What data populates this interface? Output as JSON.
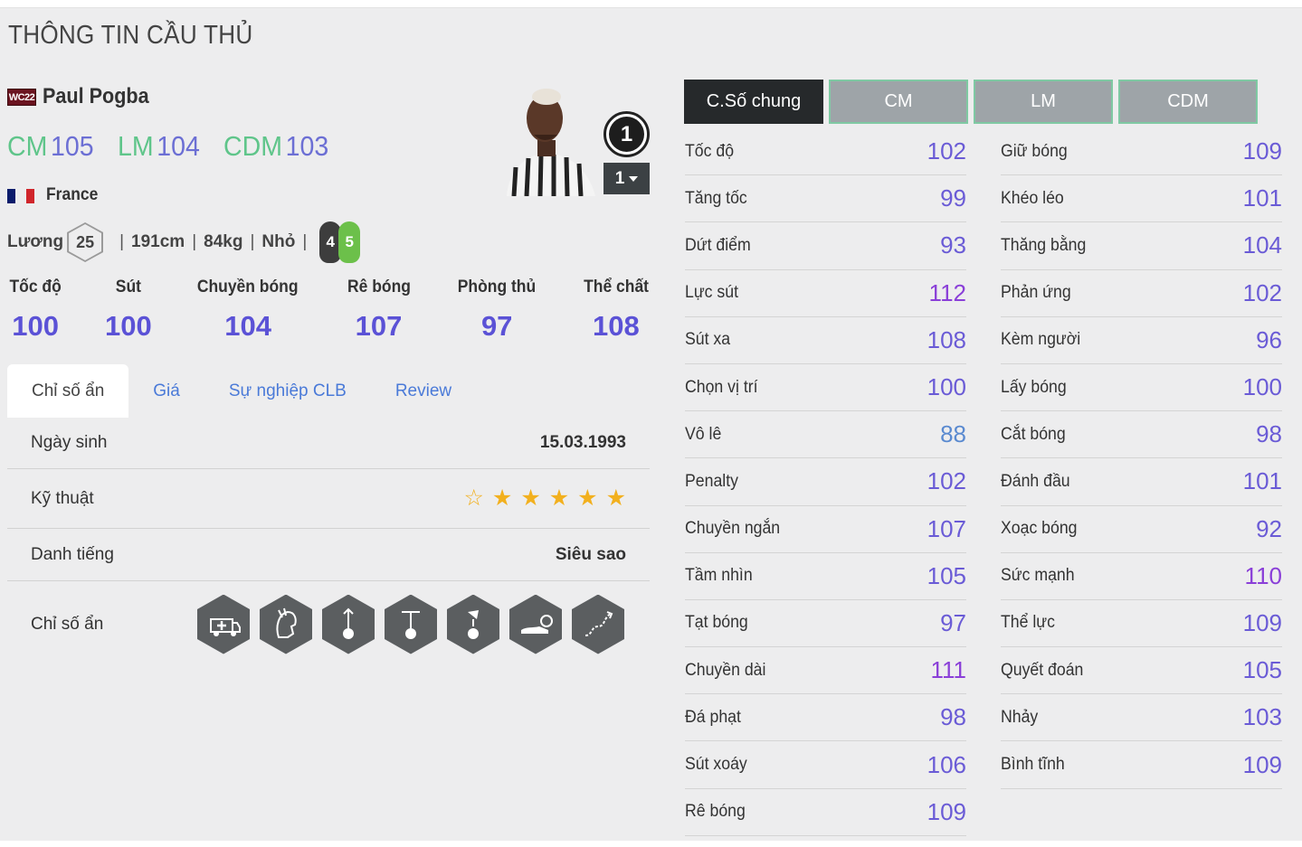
{
  "page": {
    "title": "THÔNG TIN CẦU THỦ"
  },
  "player": {
    "season_badge": "WC22",
    "name": "Paul Pogba",
    "positions": [
      {
        "pos": "CM",
        "value": "105"
      },
      {
        "pos": "LM",
        "value": "104"
      },
      {
        "pos": "CDM",
        "value": "103"
      }
    ],
    "nation": "France",
    "salary_label": "Lương",
    "salary": "25",
    "height": "191cm",
    "weight": "84kg",
    "body_type": "Nhỏ",
    "left_foot": "4",
    "right_foot": "5",
    "ovr_level": "1",
    "upgrade_level": "1"
  },
  "summary": [
    {
      "label": "Tốc độ",
      "value": "100"
    },
    {
      "label": "Sút",
      "value": "100"
    },
    {
      "label": "Chuyền bóng",
      "value": "104"
    },
    {
      "label": "Rê bóng",
      "value": "107"
    },
    {
      "label": "Phòng thủ",
      "value": "97"
    },
    {
      "label": "Thể chất",
      "value": "108"
    }
  ],
  "tabs": [
    "Chỉ số ẩn",
    "Giá",
    "Sự nghiệp CLB",
    "Review"
  ],
  "details": {
    "birth_label": "Ngày sinh",
    "birth_value": "15.03.1993",
    "skill_label": "Kỹ thuật",
    "skill_stars": 5,
    "fame_label": "Danh tiếng",
    "fame_value": "Siêu sao",
    "traits_label": "Chỉ số ẩn",
    "trait_icons": [
      "ambulance-icon",
      "spartan-helmet-icon",
      "long-shot-icon",
      "power-header-icon",
      "flair-ball-icon",
      "speed-boot-icon",
      "dribble-path-icon"
    ]
  },
  "stat_tabs": [
    "C.Số chung",
    "CM",
    "LM",
    "CDM"
  ],
  "stats_left": [
    {
      "label": "Tốc độ",
      "value": "102"
    },
    {
      "label": "Tăng tốc",
      "value": "99"
    },
    {
      "label": "Dứt điểm",
      "value": "93"
    },
    {
      "label": "Lực sút",
      "value": "112"
    },
    {
      "label": "Sút xa",
      "value": "108"
    },
    {
      "label": "Chọn vị trí",
      "value": "100"
    },
    {
      "label": "Vô lê",
      "value": "88"
    },
    {
      "label": "Penalty",
      "value": "102"
    },
    {
      "label": "Chuyền ngắn",
      "value": "107"
    },
    {
      "label": "Tầm nhìn",
      "value": "105"
    },
    {
      "label": "Tạt bóng",
      "value": "97"
    },
    {
      "label": "Chuyền dài",
      "value": "111"
    },
    {
      "label": "Đá phạt",
      "value": "98"
    },
    {
      "label": "Sút xoáy",
      "value": "106"
    },
    {
      "label": "Rê bóng",
      "value": "109"
    }
  ],
  "stats_right": [
    {
      "label": "Giữ bóng",
      "value": "109"
    },
    {
      "label": "Khéo léo",
      "value": "101"
    },
    {
      "label": "Thăng bằng",
      "value": "104"
    },
    {
      "label": "Phản ứng",
      "value": "102"
    },
    {
      "label": "Kèm người",
      "value": "96"
    },
    {
      "label": "Lấy bóng",
      "value": "100"
    },
    {
      "label": "Cắt bóng",
      "value": "98"
    },
    {
      "label": "Đánh đầu",
      "value": "101"
    },
    {
      "label": "Xoạc bóng",
      "value": "92"
    },
    {
      "label": "Sức mạnh",
      "value": "110"
    },
    {
      "label": "Thể lực",
      "value": "109"
    },
    {
      "label": "Quyết đoán",
      "value": "105"
    },
    {
      "label": "Nhảy",
      "value": "103"
    },
    {
      "label": "Bình tĩnh",
      "value": "109"
    }
  ]
}
